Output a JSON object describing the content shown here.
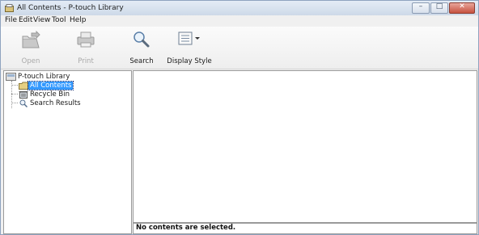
{
  "window": {
    "title": "All Contents - P-touch Library"
  },
  "menubar": {
    "items": [
      "File",
      "Edit",
      "View",
      "Tool",
      "Help"
    ]
  },
  "toolbar": {
    "open_label": "Open",
    "print_label": "Print",
    "search_label": "Search",
    "display_style_label": "Display Style",
    "disabled_color": "#a9a9a9"
  },
  "tree": {
    "root": "P-touch Library",
    "children": [
      "All Contents",
      "Recycle Bin",
      "Search Results"
    ],
    "selected": "All Contents",
    "selection_color": "#3399ff"
  },
  "status": {
    "text": "No contents are selected."
  }
}
